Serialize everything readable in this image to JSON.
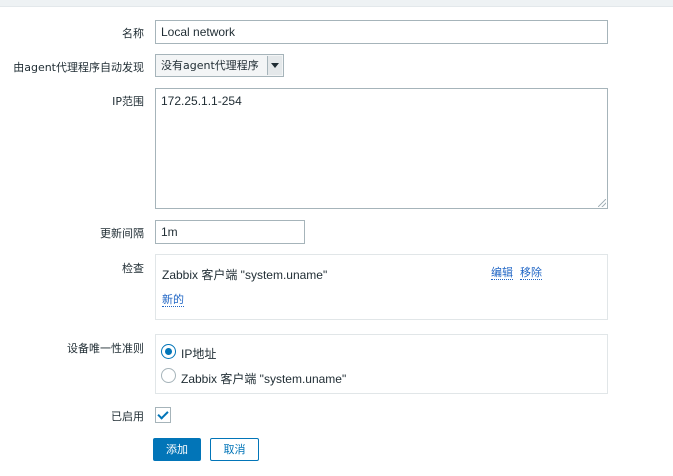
{
  "form": {
    "name": {
      "label": "名称",
      "value": "Local network"
    },
    "proxy": {
      "label": "由agent代理程序自动发现",
      "selected": "没有agent代理程序"
    },
    "ip_range": {
      "label": "IP范围",
      "value": "172.25.1.1-254"
    },
    "update_interval": {
      "label": "更新间隔",
      "value": "1m"
    },
    "checks": {
      "label": "检查",
      "items": [
        {
          "name": "Zabbix 客户端 \"system.uname\"",
          "edit_label": "编辑",
          "remove_label": "移除"
        }
      ],
      "new_label": "新的"
    },
    "uniqueness": {
      "label": "设备唯一性准则",
      "options": [
        {
          "label": "IP地址",
          "checked": true
        },
        {
          "label": "Zabbix 客户端 \"system.uname\"",
          "checked": false
        }
      ]
    },
    "enabled": {
      "label": "已启用",
      "checked": true
    },
    "buttons": {
      "add": "添加",
      "cancel": "取消"
    }
  },
  "colors": {
    "accent": "#0275b8",
    "link": "#1f65c5",
    "border": "#a6b4ba"
  }
}
